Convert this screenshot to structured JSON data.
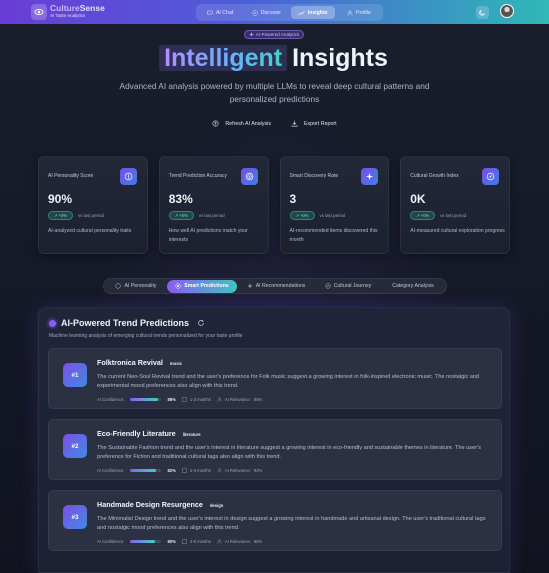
{
  "app": {
    "brand_a": "Culture",
    "brand_b": "Sense",
    "subtitle": "AI Taste Analytics"
  },
  "nav": {
    "tabs": [
      {
        "label": "AI Chat",
        "icon": "chat-icon",
        "active": false
      },
      {
        "label": "Discover",
        "icon": "compass-icon",
        "active": false
      },
      {
        "label": "Insights",
        "icon": "trend-icon",
        "active": true
      },
      {
        "label": "Profile",
        "icon": "user-icon",
        "active": false
      }
    ]
  },
  "hero": {
    "badge": "AI-Powered Analytics",
    "title_highlight": "Intelligent",
    "title_rest": "Insights",
    "subtitle": "Advanced AI analysis powered by multiple LLMs to reveal deep cultural patterns and personalized predictions",
    "refresh_label": "Refresh AI Analysis",
    "export_label": "Export Report"
  },
  "stats": [
    {
      "label": "AI Personality Score",
      "value": "90%",
      "trend": "+0%",
      "trend_note": "vs last period",
      "desc": "AI-analyzed cultural personality traits",
      "icon": "brain-icon"
    },
    {
      "label": "Trend Prediction Accuracy",
      "value": "83%",
      "trend": "+0%",
      "trend_note": "vs last period",
      "desc": "How well AI predictions match your interests",
      "icon": "target-icon"
    },
    {
      "label": "Smart Discovery Rate",
      "value": "3",
      "trend": "+0%",
      "trend_note": "vs last period",
      "desc": "AI-recommended items discovered this month",
      "icon": "sparkle-icon"
    },
    {
      "label": "Cultural Growth Index",
      "value": "0K",
      "trend": "+0%",
      "trend_note": "vs last period",
      "desc": "AI-measured cultural exploration progress",
      "icon": "compass-icon"
    }
  ],
  "segments": [
    {
      "label": "AI Personality",
      "active": false
    },
    {
      "label": "Smart Predictions",
      "active": true
    },
    {
      "label": "AI Recommendations",
      "active": false
    },
    {
      "label": "Cultural Journey",
      "active": false
    },
    {
      "label": "Category Analysis",
      "active": false
    }
  ],
  "panel": {
    "title": "AI-Powered Trend Predictions",
    "subtitle": "Machine learning analysis of emerging cultural trends personalized for your taste profile",
    "confidence_label": "AI Confidence:",
    "relevance_label": "AI Relevance:",
    "trends": [
      {
        "rank": "#1",
        "title": "Folktronica Revival",
        "tag": "music",
        "desc": "The current Neo-Soul Revival trend and the user's preference for Folk music suggest a growing interest in folk-inspired electronic music. The nostalgic and experimental mood preferences also align with this trend.",
        "confidence": 88,
        "confidence_text": "88%",
        "timeframe": "1-3 months",
        "relevance": "85%"
      },
      {
        "rank": "#2",
        "title": "Eco-Friendly Literature",
        "tag": "literature",
        "desc": "The Sustainable Fashion trend and the user's interest in literature suggest a growing interest in eco-friendly and sustainable themes in literature. The user's preference for Fiction and traditional cultural tags also align with this trend.",
        "confidence": 82,
        "confidence_text": "82%",
        "timeframe": "2-4 months",
        "relevance": "92%"
      },
      {
        "rank": "#3",
        "title": "Handmade Design Resurgence",
        "tag": "design",
        "desc": "The Minimalist Design trend and the user's interest in design suggest a growing interest in handmade and artisanal design. The user's traditional cultural tags and nostalgic mood preferences also align with this trend.",
        "confidence": 80,
        "confidence_text": "80%",
        "timeframe": "3-6 months",
        "relevance": "88%"
      }
    ]
  },
  "colors": {
    "accent_purple": "#8b5cf0",
    "accent_teal": "#3fd1c0",
    "background": "#161a27"
  }
}
